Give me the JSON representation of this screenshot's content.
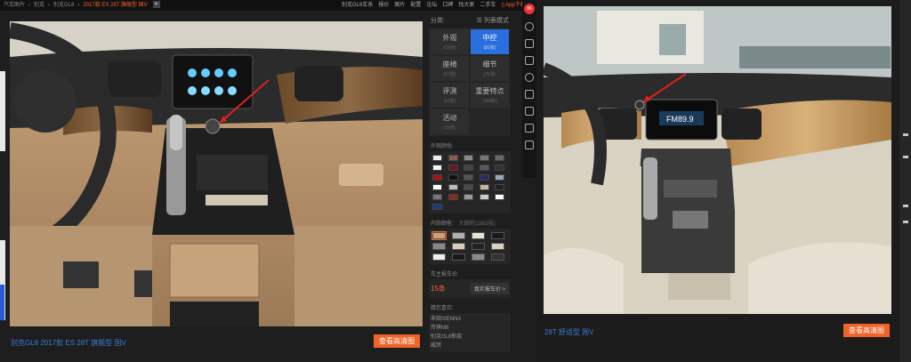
{
  "left": {
    "breadcrumb": [
      "汽车图片",
      "别克",
      "别克GL8"
    ],
    "current_model": "2017款 ES 28T 旗舰型 国V",
    "topnav": [
      "别克GL8车系",
      "报价",
      "图片",
      "配置",
      "论坛",
      "口碑",
      "找大家",
      "二手车"
    ],
    "app_download": "App下载",
    "caption": "别克GL8 2017款 ES 28T 旗舰型 国V",
    "hd_button": "查看高清图",
    "panel": {
      "category_label": "分类:",
      "list_mode": "列表模式",
      "categories": [
        {
          "label": "外观",
          "count": "(16张)",
          "active": false
        },
        {
          "label": "中控",
          "count": "(81张)",
          "active": true
        },
        {
          "label": "座椅",
          "count": "(67张)",
          "active": false
        },
        {
          "label": "细节",
          "count": "(75张)",
          "active": false
        },
        {
          "label": "评测",
          "count": "(16张)",
          "active": false
        },
        {
          "label": "重要特点",
          "count": "(344张)",
          "active": false
        },
        {
          "label": "活动",
          "count": "(16张)",
          "active": false
        }
      ],
      "exterior_color_label": "外观颜色:",
      "exterior_colors": [
        "#eeeeee",
        "#8a5a4a",
        "#888888",
        "#777777",
        "#666666",
        "#f5f5f5",
        "#6a1a1a",
        "#444444",
        "#5a5a5a",
        "#333333",
        "#aa1111",
        "#111111",
        "#555555",
        "#2a2a6a",
        "#9aa8b8",
        "#ffffff",
        "#bbbbbb",
        "#4a4a4a",
        "#c8b89a",
        "#222222",
        "#777777",
        "#8a2a1a",
        "#999999",
        "#cccccc",
        "#ffffff",
        "#1a3a7a"
      ],
      "interior_color_label": "内饰颜色:",
      "interior_extra": "大面积(1883张)",
      "interior_colors": [
        "#c9a27a",
        "#b0b0b0",
        "#e8e2d5",
        "#1a1a1a",
        "#888888",
        "#d8cdb8",
        "#222222",
        "#d8d0c0",
        "#eeeeee",
        "#1a1a1a",
        "#8a8a8a",
        "#333333"
      ],
      "dealer_label": "车主报车价:",
      "dealer_count": "15条",
      "dealer_link": "真实报车价 >",
      "compete_label": "猜您喜欢:",
      "compete_items": [
        "丰田SIENNA",
        "传祺M8",
        "别克GL8新款",
        "威然"
      ]
    }
  },
  "right": {
    "caption": "28T 舒适型 国V",
    "hd_button": "查看高清图"
  },
  "sidebar": {
    "user_count": "86",
    "icons": [
      "avatar",
      "clock-icon",
      "compare-icon",
      "parameter-icon",
      "bulb-icon",
      "car-icon",
      "car-side-icon",
      "dealer-icon",
      "gift-icon"
    ]
  }
}
